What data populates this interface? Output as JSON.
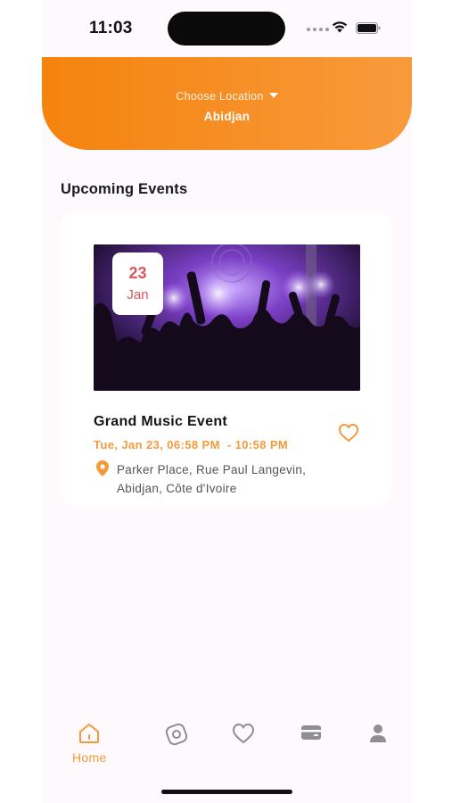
{
  "status_bar": {
    "time": "11:03"
  },
  "header": {
    "choose_location_label": "Choose Location",
    "city": "Abidjan"
  },
  "section": {
    "title": "Upcoming Events"
  },
  "event": {
    "day": "23",
    "month": "Jan",
    "title": "Grand Music Event",
    "time": "Tue, Jan 23, 06:58 PM  - 10:58 PM",
    "address_line1": "Parker Place, Rue Paul Langevin,",
    "address_line2": "Abidjan, Côte d'Ivoire"
  },
  "nav": {
    "items": [
      {
        "label": "Home",
        "icon": "home-icon",
        "active": true
      },
      {
        "label": "",
        "icon": "explore-icon",
        "active": false
      },
      {
        "label": "",
        "icon": "heart-icon",
        "active": false
      },
      {
        "label": "",
        "icon": "ticket-icon",
        "active": false
      },
      {
        "label": "",
        "icon": "profile-icon",
        "active": false
      }
    ]
  },
  "colors": {
    "accent": "#f5830d",
    "accent_light": "#f89a3c",
    "date_red": "#e0555e",
    "inactive_icon": "#8e8e93"
  }
}
